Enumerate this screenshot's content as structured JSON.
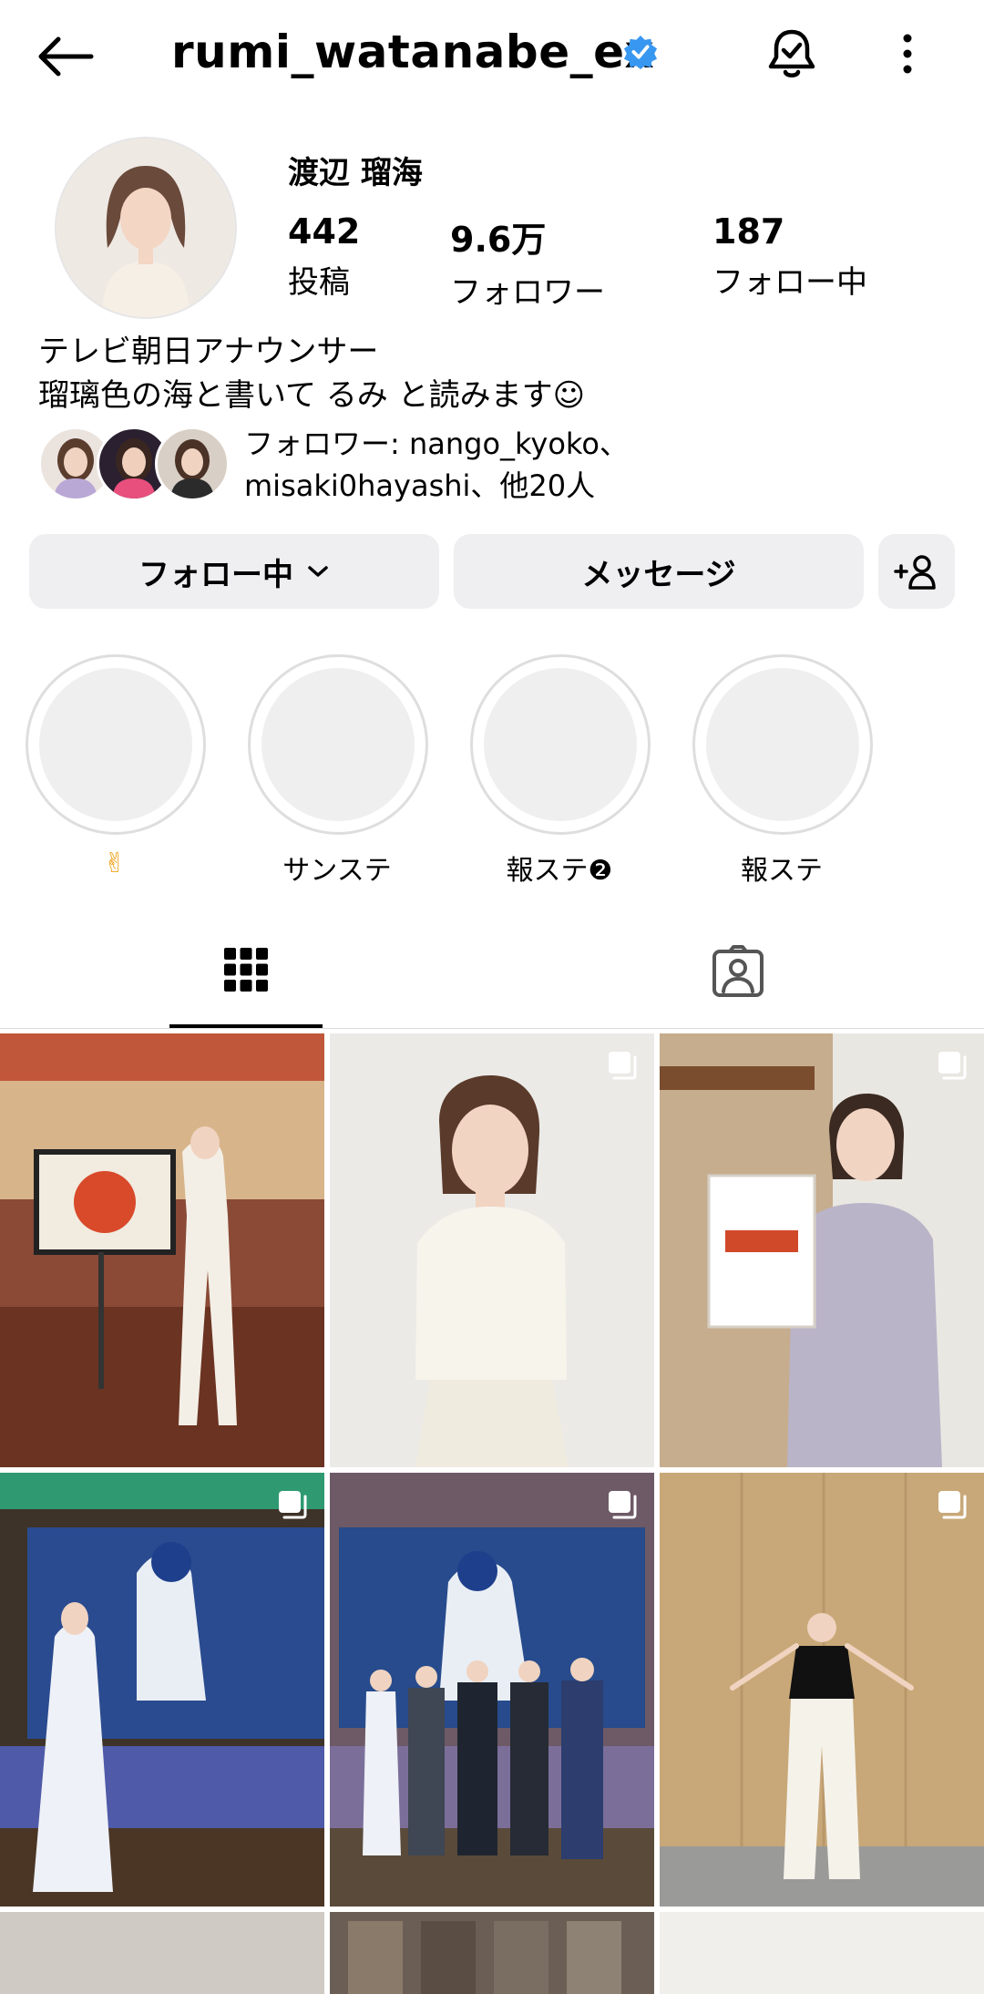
{
  "header": {
    "username": "rumi_watanabe_ex",
    "verified_color": "#3897f0"
  },
  "profile": {
    "display_name": "渡辺 瑠海",
    "stats": [
      {
        "value": "442",
        "label": "投稿"
      },
      {
        "value": "9.6万",
        "label": "フォロワー"
      },
      {
        "value": "187",
        "label": "フォロー中"
      }
    ],
    "bio_line1": "テレビ朝日アナウンサー",
    "bio_line2": "瑠璃色の海と書いて るみ と読みます☺",
    "mutual_line1": "フォロワー: nango_kyoko、",
    "mutual_line2": "misaki0hayashi、他20人"
  },
  "actions": {
    "follow_label": "フォロー中",
    "message_label": "メッセージ"
  },
  "highlights": [
    {
      "label": "✌"
    },
    {
      "label": "サンステ"
    },
    {
      "label": "報ステ❷"
    },
    {
      "label": "報ステ"
    }
  ],
  "tabs": [
    {
      "icon": "grid-icon",
      "active": true
    },
    {
      "icon": "tagged-person-icon",
      "active": false
    }
  ],
  "grid_posts": [
    {
      "multi": false
    },
    {
      "multi": true
    },
    {
      "multi": true
    },
    {
      "multi": true
    },
    {
      "multi": true
    },
    {
      "multi": true
    }
  ],
  "colors": {
    "accent": "#3897f0",
    "button_bg": "#efeff1"
  }
}
